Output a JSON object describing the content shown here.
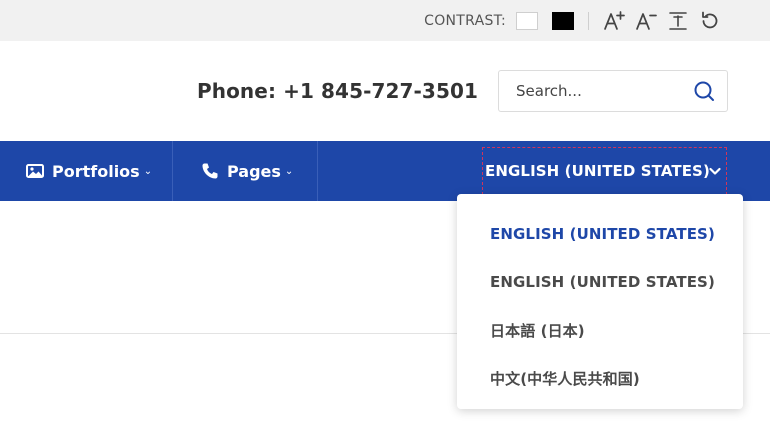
{
  "colors": {
    "brand_blue": "#1e47a8",
    "active_language": "#1e47a8",
    "text_dark": "#333333",
    "focus_outline": "#d0345c"
  },
  "accessibility": {
    "contrast_label": "CONTRAST:",
    "swatches": [
      "white",
      "black"
    ],
    "tools": [
      "increase-font-icon",
      "decrease-font-icon",
      "reset-font-icon",
      "reset-icon"
    ]
  },
  "header": {
    "phone": "Phone: +1 845-727-3501",
    "search": {
      "placeholder": "Search...",
      "value": ""
    }
  },
  "nav": {
    "items": [
      {
        "label": "Portfolios",
        "icon": "image-icon"
      },
      {
        "label": "Pages",
        "icon": "phone-icon"
      }
    ]
  },
  "language": {
    "selected": "ENGLISH (UNITED STATES)",
    "options": [
      {
        "label": "ENGLISH (UNITED STATES)",
        "active": true
      },
      {
        "label": "ENGLISH (UNITED STATES)",
        "active": false
      },
      {
        "label": "日本語 (日本)",
        "active": false
      },
      {
        "label": "中文(中华人民共和国)",
        "active": false
      }
    ]
  }
}
